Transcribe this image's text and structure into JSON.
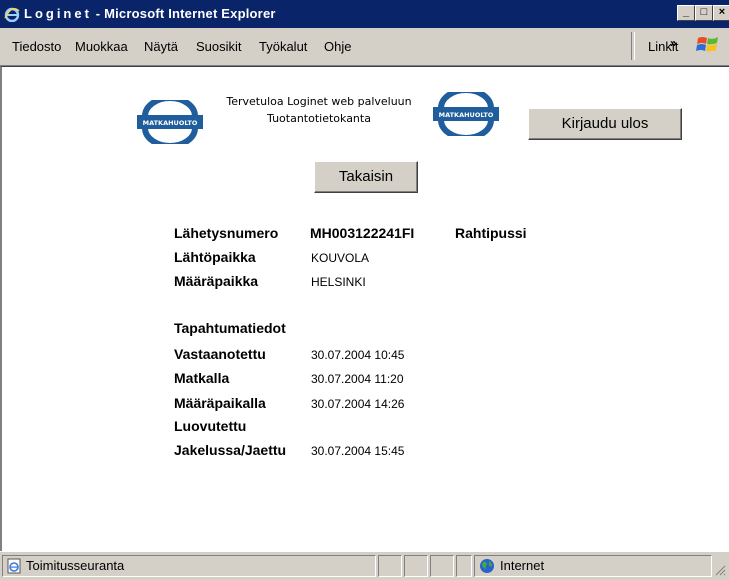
{
  "window": {
    "title_spaced": "Loginet",
    "title_rest": " - Microsoft Internet Explorer",
    "minimize_glyph": "_",
    "maximize_glyph": "□",
    "close_glyph": "×"
  },
  "menu": {
    "items": [
      "Tiedosto",
      "Muokkaa",
      "Näytä",
      "Suosikit",
      "Työkalut",
      "Ohje"
    ],
    "links_label": "Linkit",
    "links_chevron": "»"
  },
  "page": {
    "logo_text": "MATKAHUOLTO",
    "welcome_line1": "Tervetuloa Loginet web palveluun",
    "welcome_line2": "Tuotantotietokanta",
    "logout_button": "Kirjaudu ulos",
    "back_button": "Takaisin",
    "shipment": {
      "number_label": "Lähetysnumero",
      "number_value": "MH003122241FI",
      "type_value": "Rahtipussi",
      "origin_label": "Lähtöpaikka",
      "origin_value": "KOUVOLA",
      "destination_label": "Määräpaikka",
      "destination_value": "HELSINKI"
    },
    "events": {
      "heading": "Tapahtumatiedot",
      "rows": [
        {
          "label": "Vastaanotettu",
          "value": "30.07.2004 10:45"
        },
        {
          "label": "Matkalla",
          "value": "30.07.2004 11:20"
        },
        {
          "label": "Määräpaikalla",
          "value": "30.07.2004 14:26"
        },
        {
          "label": "Luovutettu",
          "value": ""
        },
        {
          "label": "Jakelussa/Jaettu",
          "value": "30.07.2004 15:45"
        }
      ]
    }
  },
  "status": {
    "left_text": "Toimitusseuranta",
    "zone_text": "Internet"
  },
  "colors": {
    "titlebar": "#0a246a",
    "chrome": "#d4d0c8",
    "logo_blue": "#1f5d9c"
  }
}
